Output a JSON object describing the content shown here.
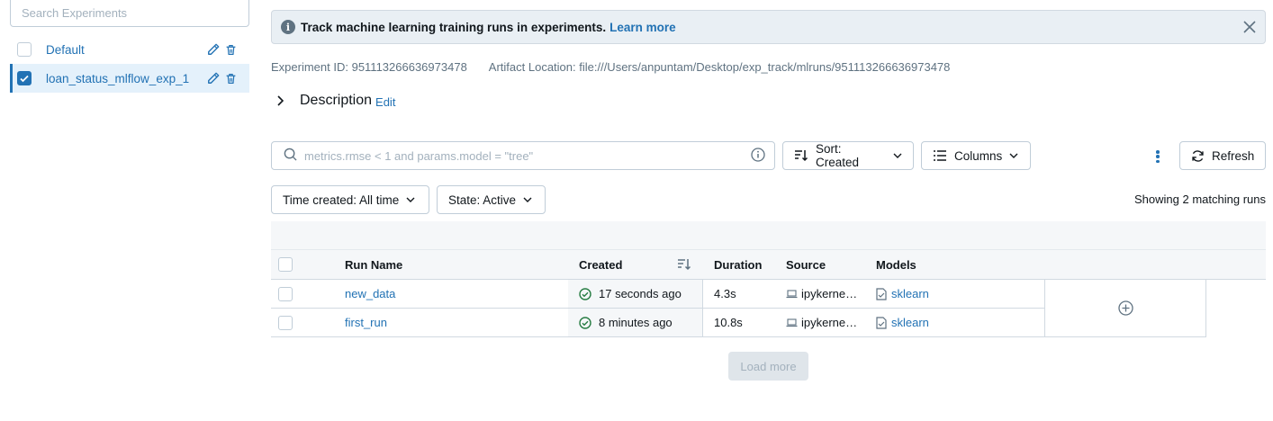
{
  "sidebar": {
    "search_placeholder": "Search Experiments",
    "experiments": [
      {
        "name": "Default",
        "selected": false
      },
      {
        "name": "loan_status_mlflow_exp_1",
        "selected": true
      }
    ]
  },
  "banner": {
    "message": "Track machine learning training runs in experiments.",
    "link": "Learn more"
  },
  "experiment": {
    "id_label": "Experiment ID: 951113266636973478",
    "artifact_label": "Artifact Location: file:///Users/anpuntam/Desktop/exp_track/mlruns/951113266636973478"
  },
  "description": {
    "title": "Description",
    "edit": "Edit"
  },
  "toolbar": {
    "search_placeholder": "metrics.rmse < 1 and params.model = \"tree\"",
    "sort_label": "Sort: Created",
    "columns_label": "Columns",
    "refresh_label": "Refresh"
  },
  "filters": {
    "time_created": "Time created: All time",
    "state": "State: Active",
    "showing": "Showing 2 matching runs"
  },
  "table": {
    "headers": {
      "run_name": "Run Name",
      "created": "Created",
      "duration": "Duration",
      "source": "Source",
      "models": "Models"
    },
    "rows": [
      {
        "run_name": "new_data",
        "created": "17 seconds ago",
        "duration": "4.3s",
        "source": "ipykerne…",
        "model": "sklearn"
      },
      {
        "run_name": "first_run",
        "created": "8 minutes ago",
        "duration": "10.8s",
        "source": "ipykerne…",
        "model": "sklearn"
      }
    ]
  },
  "load_more": "Load more",
  "colors": {
    "accent": "#2272b4",
    "success": "#277c43",
    "muted": "#5f7281"
  }
}
